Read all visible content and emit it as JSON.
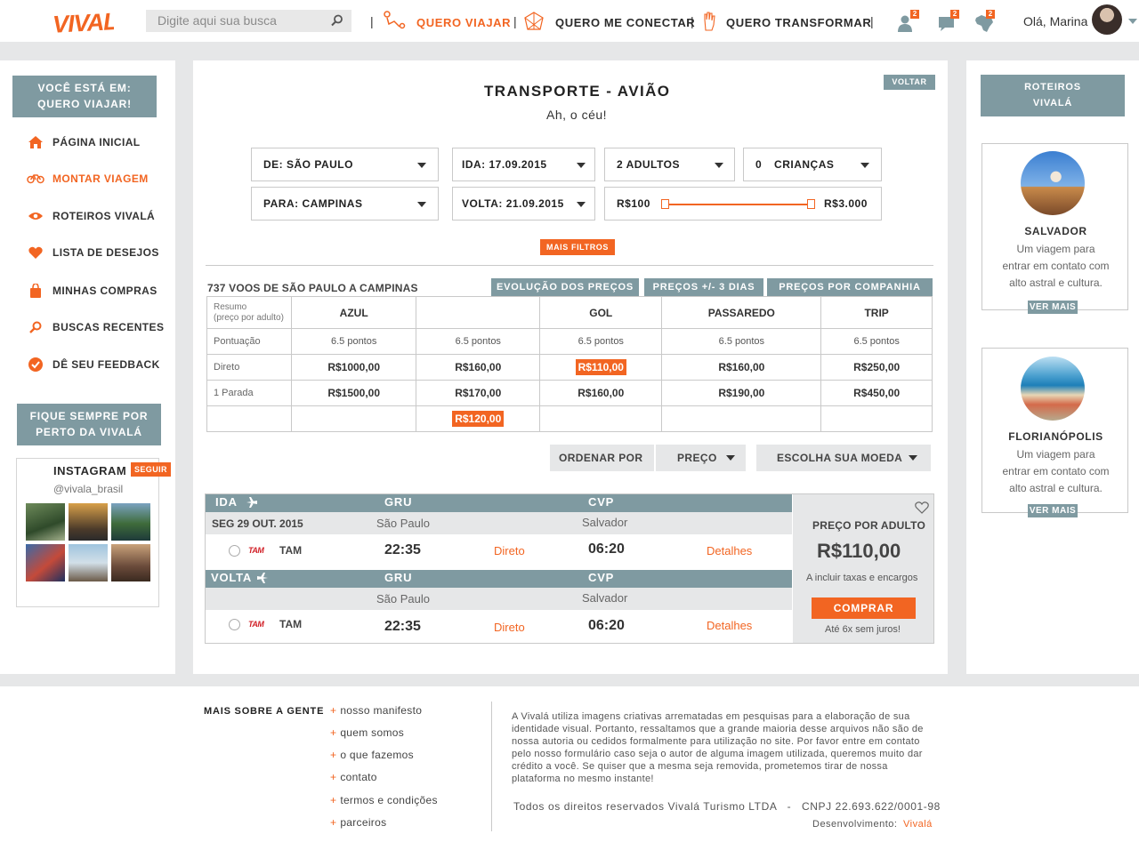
{
  "header": {
    "logo": "VIVALÁ",
    "search_placeholder": "Digite aqui sua busca",
    "nav": [
      {
        "label": "QUERO VIAJAR",
        "active": true
      },
      {
        "label": "QUERO ME CONECTAR",
        "active": false
      },
      {
        "label": "QUERO TRANSFORMAR",
        "active": false
      }
    ],
    "separator": "|",
    "badges": {
      "profile": "2",
      "messages": "2",
      "map": "2"
    },
    "greeting": "Olá, Marina"
  },
  "left": {
    "location_title": "VOCÊ ESTÁ EM:",
    "location_value": "QUERO VIAJAR!",
    "menu": [
      {
        "label": "PÁGINA INICIAL",
        "icon": "home-icon"
      },
      {
        "label": "MONTAR VIAGEM",
        "icon": "bike-icon"
      },
      {
        "label": "ROTEIROS VIVALÁ",
        "icon": "eye-icon"
      },
      {
        "label": "LISTA DE DESEJOS",
        "icon": "heart-icon"
      },
      {
        "label": "MINHAS COMPRAS",
        "icon": "shopping-bag-icon"
      },
      {
        "label": "BUSCAS RECENTES",
        "icon": "search-icon"
      },
      {
        "label": "DÊ SEU FEEDBACK",
        "icon": "check-icon"
      }
    ],
    "follow_title_1": "FIQUE SEMPRE POR",
    "follow_title_2": "PERTO DA VIVALÁ",
    "instagram_title": "INSTAGRAM",
    "instagram_follow": "SEGUIR",
    "instagram_handle": "@vivala_brasil"
  },
  "main": {
    "title": "TRANSPORTE - AVIÃO",
    "subtitle": "Ah, o céu!",
    "back": "VOLTAR",
    "filters": {
      "from": "DE: SÃO PAULO",
      "to": "PARA: CAMPINAS",
      "depart": "IDA: 17.09.2015",
      "return": "VOLTA: 21.09.2015",
      "adults": "2 ADULTOS",
      "children_count": "0",
      "children_label": "CRIANÇAS",
      "price_min": "R$100",
      "price_max": "R$3.000",
      "more_filters": "MAIS FILTROS"
    },
    "results_count": "737 VOOS DE SÃO PAULO A CAMPINAS",
    "tabs": [
      "EVOLUÇÃO DOS PREÇOS",
      "PREÇOS +/- 3 DIAS",
      "PREÇOS POR COMPANHIA"
    ],
    "table": {
      "header_label_1": "Resumo",
      "header_label_2": "(preço por adulto)",
      "airlines": [
        "AZUL",
        "",
        "GOL",
        "PASSAREDO",
        "TRIP"
      ],
      "rows": [
        {
          "label": "Pontuação",
          "cells": [
            "6.5 pontos",
            "6.5 pontos",
            "6.5 pontos",
            "6.5 pontos",
            "6.5 pontos"
          ]
        },
        {
          "label": "Direto",
          "cells": [
            "R$1000,00",
            "R$160,00",
            "R$110,00",
            "R$160,00",
            "R$250,00"
          ]
        },
        {
          "label": "1 Parada",
          "cells": [
            "R$1500,00",
            "R$170,00",
            "R$160,00",
            "R$190,00",
            "R$450,00"
          ]
        },
        {
          "label": "",
          "cells": [
            "",
            "R$120,00",
            "",
            "",
            ""
          ]
        }
      ]
    },
    "sort": {
      "label": "ORDENAR POR",
      "value": "PREÇO",
      "currency": "ESCOLHA SUA MOEDA"
    },
    "flight": {
      "outbound": {
        "label": "IDA",
        "from_code": "GRU",
        "to_code": "CVP",
        "date": "SEG 29 OUT. 2015",
        "from_city": "São Paulo",
        "to_city": "Salvador",
        "airline": "TAM",
        "dep": "22:35",
        "type": "Direto",
        "arr": "06:20",
        "details": "Detalhes"
      },
      "inbound": {
        "label": "VOLTA",
        "from_code": "GRU",
        "to_code": "CVP",
        "from_city": "São Paulo",
        "to_city": "Salvador",
        "airline": "TAM",
        "dep": "22:35",
        "type": "Direto",
        "arr": "06:20",
        "details": "Detalhes"
      },
      "price_label": "PREÇO POR ADULTO",
      "price": "R$110,00",
      "taxes": "A incluir taxas e encargos",
      "buy": "COMPRAR",
      "installments": "Até 6x sem juros!"
    }
  },
  "right": {
    "title_1": "ROTEIROS",
    "title_2": "VIVALÁ",
    "cards": [
      {
        "city": "SALVADOR",
        "desc": [
          "Um viagem para",
          "entrar em contato com",
          "alto astral e cultura."
        ],
        "more": "VER MAIS"
      },
      {
        "city": "FLORIANÓPOLIS",
        "desc": [
          "Um viagem para",
          "entrar em contato com",
          "alto astral e cultura."
        ],
        "more": "VER MAIS"
      }
    ]
  },
  "footer": {
    "heading": "MAIS SOBRE A GENTE",
    "links": [
      "nosso manifesto",
      "quem somos",
      "o que fazemos",
      "contato",
      "termos e condições",
      "parceiros"
    ],
    "disclaimer": "A Vivalá utiliza imagens criativas arrematadas em pesquisas para a elaboração de sua identidade visual. Portanto, ressaltamos que a grande maioria desse arquivos não são de nossa autoria ou cedidos formalmente para utilização no site. Por favor entre em contato pelo nosso formulário caso seja o autor de alguma imagem utilizada, queremos muito dar crédito a você. Se quiser que a mesma seja removida, prometemos tirar de nossa plataforma no mesmo instante!",
    "rights": "Todos os direitos reservados Vivalá Turismo LTDA   -   CNPJ 22.693.622/0001-98",
    "dev_label": "Desenvolvimento:",
    "dev_name": "Vivalá"
  },
  "colors": {
    "accent": "#f26522",
    "slate": "#7f9aa1",
    "background": "#e6e7e8"
  }
}
